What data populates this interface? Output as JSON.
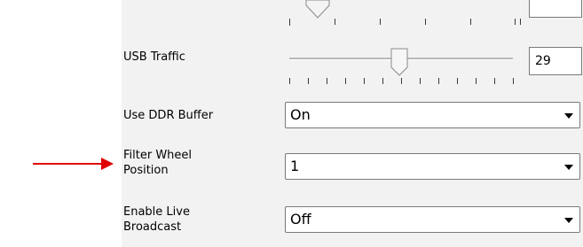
{
  "settings": {
    "usb_traffic": {
      "label": "USB Traffic",
      "value": "29"
    },
    "ddr_buffer": {
      "label": "Use DDR Buffer",
      "selected": "On"
    },
    "filter_wheel": {
      "label_line1": "Filter Wheel",
      "label_line2": "Position",
      "selected": "1"
    },
    "live_broadcast": {
      "label_line1": "Enable Live",
      "label_line2": "Broadcast",
      "selected": "Off"
    }
  },
  "icons": [
    "slider-thumb-icon",
    "dropdown-arrow-icon",
    "red-arrow-icon"
  ],
  "colors": {
    "panel_bg": "#f2f2f2",
    "annotation_arrow": "#e00000"
  }
}
